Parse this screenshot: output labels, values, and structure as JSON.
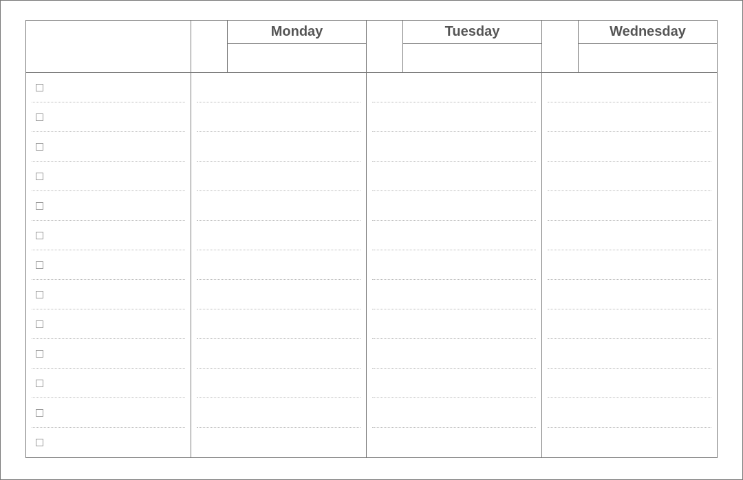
{
  "planner": {
    "days": [
      {
        "label": "Monday"
      },
      {
        "label": "Tuesday"
      },
      {
        "label": "Wednesday"
      }
    ],
    "rows": [
      {
        "task": "",
        "mon": "",
        "tue": "",
        "wed": ""
      },
      {
        "task": "",
        "mon": "",
        "tue": "",
        "wed": ""
      },
      {
        "task": "",
        "mon": "",
        "tue": "",
        "wed": ""
      },
      {
        "task": "",
        "mon": "",
        "tue": "",
        "wed": ""
      },
      {
        "task": "",
        "mon": "",
        "tue": "",
        "wed": ""
      },
      {
        "task": "",
        "mon": "",
        "tue": "",
        "wed": ""
      },
      {
        "task": "",
        "mon": "",
        "tue": "",
        "wed": ""
      },
      {
        "task": "",
        "mon": "",
        "tue": "",
        "wed": ""
      },
      {
        "task": "",
        "mon": "",
        "tue": "",
        "wed": ""
      },
      {
        "task": "",
        "mon": "",
        "tue": "",
        "wed": ""
      },
      {
        "task": "",
        "mon": "",
        "tue": "",
        "wed": ""
      },
      {
        "task": "",
        "mon": "",
        "tue": "",
        "wed": ""
      },
      {
        "task": "",
        "mon": "",
        "tue": "",
        "wed": ""
      }
    ]
  }
}
